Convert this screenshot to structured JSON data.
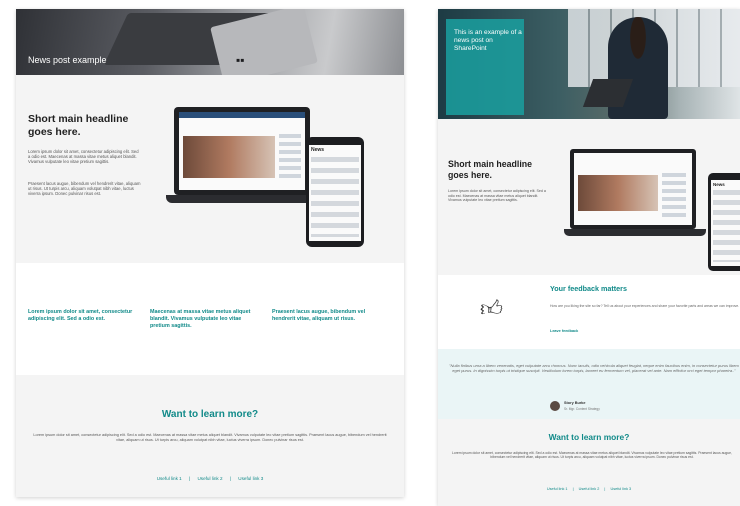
{
  "left": {
    "hero_caption": "News post example",
    "headline": "Short main headline goes here.",
    "body1": "Lorem ipsum dolor sit amet, consectetur adipiscing elit. Sed a odio est. Maecenas at massa vitae metus aliquet blandit. Vivamus vulputate leo vitae pretium sagittis.",
    "body2": "Praesent lacus augue, bibendum vel hendrerit vitae, aliquam ut risus. Ut turpis arcu, aliquam volutpat nibh vitae, luctus viverra ipsum. Donec pulvinar risus est.",
    "phone_header": "News",
    "links": [
      "Lorem ipsum dolor sit amet, consectetur adipiscing elit. Sed a odio est.",
      "Maecenas at massa vitae metus aliquet blandit. Vivamus vulputate leo vitae pretium sagittis.",
      "Praesent lacus augue, bibendum vel hendrerit vitae, aliquam ut risus."
    ],
    "cta_title": "Want to learn more?",
    "cta_body": "Lorem ipsum dolor sit amet, consectetur adipiscing elit. Sed a odio est. Maecenas at massa vitae metus aliquet blandit. Vivamus vulputate leo vitae pretium sagittis. Praesent lacus augue, bibendum vel hendrerit vitae, aliquam ut risus. Ut turpis arcu, aliquam volutpat nibh vitae, luctus viverra ipsum. Donec pulvinar risus est.",
    "useful_links": [
      "Useful link 1",
      "|",
      "Useful link 2",
      "|",
      "Useful link 3"
    ]
  },
  "right": {
    "hero_caption": "This is an example of a news post on SharePoint",
    "headline": "Short main headline goes here.",
    "body": "Lorem ipsum dolor sit amet, consectetur adipiscing elit. Sed a odio est. Maecenas at massa vitae metus aliquet blandit. Vivamus vulputate leo vitae pretium sagittis.",
    "phone_header": "News",
    "feedback_title": "Your feedback matters",
    "feedback_body": "How are you liking the site so far? Tell us about your experiences and share your favorite parts and areas we can improve.",
    "feedback_link": "Leave feedback",
    "quote": "\"Nulla finibus urna a libero venenatis, eget vulputate arcu rhoncus. Nunc iaculis, odio vehicula aliquet feugiat, neque enim faucibus enim, in consectetur purus libero eget purus. In dignissim turpis ut tristique suscipit. Vestibulum lorem turpis, laoreet eu fermentum vel, placerat vel ante. Nam efficitur orci eget tempor pharetra..\"",
    "quote_name": "Story Burke",
    "quote_role": "Sr. Mgr. Content Strategy",
    "cta_title": "Want to learn more?",
    "cta_body": "Lorem ipsum dolor sit amet, consectetur adipiscing elit. Sed a odio est. Maecenas at massa vitae metus aliquet blandit. Vivamus vulputate leo vitae pretium sagittis. Praesent lacus augue, bibendum vel hendrerit vitae, aliquam ut risus. Ut turpis arcu, aliquam volutpat nibh vitae, luctus viverra ipsum. Donec pulvinar risus est.",
    "useful_links": [
      "Useful link 1",
      "|",
      "Useful link 2",
      "|",
      "Useful link 3"
    ]
  },
  "colors": {
    "accent": "#118a89",
    "panel": "#1aa0a0",
    "card_bg": "#f4f4f4"
  }
}
